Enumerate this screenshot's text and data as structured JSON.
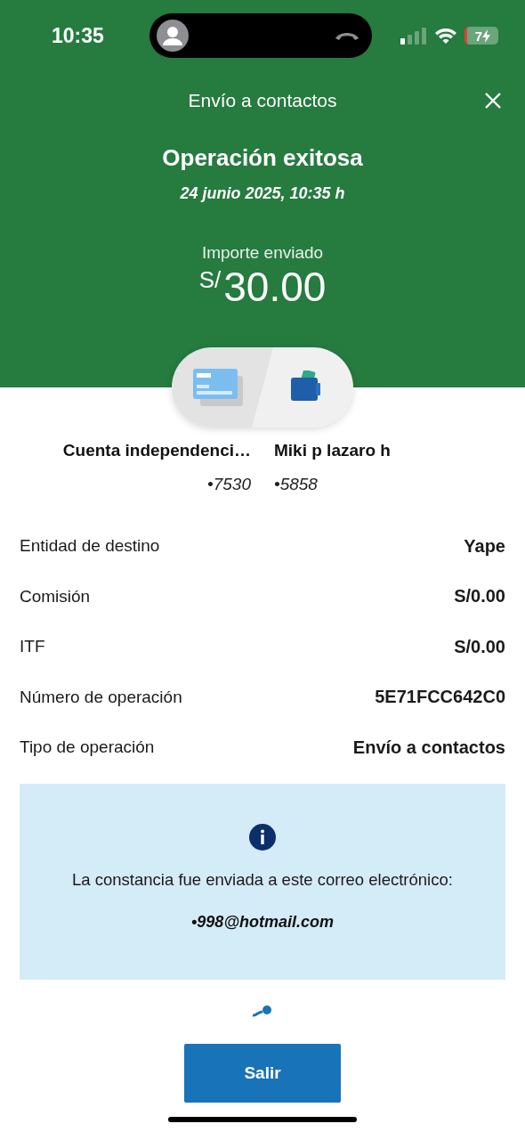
{
  "status_bar": {
    "time": "10:35",
    "battery": "7"
  },
  "header": {
    "title": "Envío a contactos",
    "result": "Operación exitosa",
    "date": "24 junio 2025, 10:35 h",
    "amount_label": "Importe enviado",
    "currency": "S/",
    "amount": "30.00"
  },
  "parties": [
    {
      "name": "Cuenta independenci…",
      "account": "•7530"
    },
    {
      "name": "Miki p lazaro h",
      "account": "•5858"
    }
  ],
  "details": [
    {
      "label": "Entidad de destino",
      "value": "Yape"
    },
    {
      "label": "Comisión",
      "value": "S/0.00"
    },
    {
      "label": "ITF",
      "value": "S/0.00"
    },
    {
      "label": "Número de operación",
      "value": "5E71FCC642C0"
    },
    {
      "label": "Tipo de operación",
      "value": "Envío a contactos"
    }
  ],
  "notice": {
    "message": "La constancia fue enviada a este correo electrónico:",
    "email": "•998@hotmail.com"
  },
  "buttons": [
    "Salir"
  ]
}
